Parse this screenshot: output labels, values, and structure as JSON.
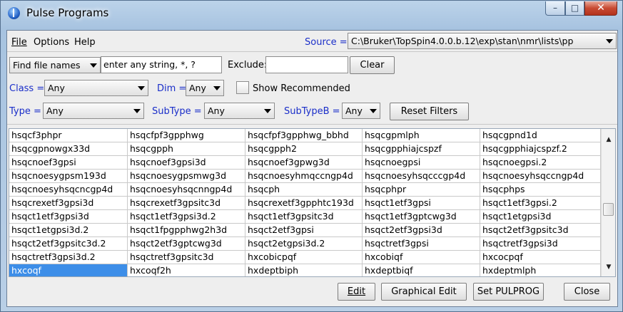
{
  "window": {
    "title": "Pulse Programs"
  },
  "menu": {
    "file": "File",
    "options": "Options",
    "help": "Help"
  },
  "source": {
    "label": "Source =",
    "value": "C:\\Bruker\\TopSpin4.0.0.b.12\\exp\\stan\\nmr\\lists\\pp"
  },
  "search": {
    "mode": "Find file names",
    "value": "enter any string, *, ?",
    "exclude_label": "Exclude:",
    "exclude_value": "",
    "clear_label": "Clear"
  },
  "filters": {
    "class_label": "Class =",
    "class_value": "Any",
    "dim_label": "Dim =",
    "dim_value": "Any",
    "show_recommended": "Show Recommended",
    "type_label": "Type =",
    "type_value": "Any",
    "subtype_label": "SubType =",
    "subtype_value": "Any",
    "subtypeb_label": "SubTypeB =",
    "subtypeb_value": "Any",
    "reset_label": "Reset Filters"
  },
  "table": {
    "selected": "hxcoqf",
    "rows": [
      [
        "hsqcf3phpr",
        "hsqcfpf3gpphwg",
        "hsqcfpf3gpphwg_bbhd",
        "hsqcgpmlph",
        "hsqcgpnd1d"
      ],
      [
        "hsqcgpnowgx33d",
        "hsqcgpph",
        "hsqcgpph2",
        "hsqcgpphiajcspzf",
        "hsqcgpphiajcspzf.2"
      ],
      [
        "hsqcnoef3gpsi",
        "hsqcnoef3gpsi3d",
        "hsqcnoef3gpwg3d",
        "hsqcnoegpsi",
        "hsqcnoegpsi.2"
      ],
      [
        "hsqcnoesygpsm193d",
        "hsqcnoesygpsmwg3d",
        "hsqcnoesyhmqccngp4d",
        "hsqcnoesyhsqcccgp4d",
        "hsqcnoesyhsqccngp4d"
      ],
      [
        "hsqcnoesyhsqcncgp4d",
        "hsqcnoesyhsqcnngp4d",
        "hsqcph",
        "hsqcphpr",
        "hsqcphps"
      ],
      [
        "hsqcrexetf3gpsi3d",
        "hsqcrexetf3gpsitc3d",
        "hsqcrexetf3gpphtc193d",
        "hsqct1etf3gpsi",
        "hsqct1etf3gpsi.2"
      ],
      [
        "hsqct1etf3gpsi3d",
        "hsqct1etf3gpsi3d.2",
        "hsqct1etf3gpsitc3d",
        "hsqct1etf3gptcwg3d",
        "hsqct1etgpsi3d"
      ],
      [
        "hsqct1etgpsi3d.2",
        "hsqct1fpgpphwg2h3d",
        "hsqct2etf3gpsi",
        "hsqct2etf3gpsi3d",
        "hsqct2etf3gpsitc3d"
      ],
      [
        "hsqct2etf3gpsitc3d.2",
        "hsqct2etf3gptcwg3d",
        "hsqct2etgpsi3d.2",
        "hsqctretf3gpsi",
        "hsqctretf3gpsi3d"
      ],
      [
        "hsqctretf3gpsi3d.2",
        "hsqctretf3gpsitc3d",
        "hxcobicpqf",
        "hxcobiqf",
        "hxcocpqf"
      ],
      [
        "hxcoqf",
        "hxcoqf2h",
        "hxdeptbiph",
        "hxdeptbiqf",
        "hxdeptmlph"
      ]
    ]
  },
  "buttons": {
    "edit": "Edit",
    "graphical_edit": "Graphical Edit",
    "set_pulprog": "Set PULPROG",
    "close": "Close"
  }
}
